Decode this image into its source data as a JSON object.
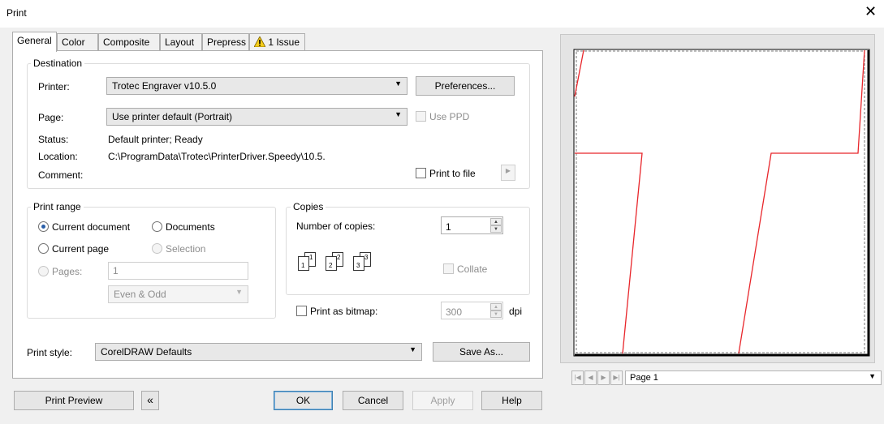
{
  "window": {
    "title": "Print",
    "close_glyph": "✕"
  },
  "tabs": [
    {
      "label": "General",
      "active": true
    },
    {
      "label": "Color"
    },
    {
      "label": "Composite"
    },
    {
      "label": "Layout"
    },
    {
      "label": "Prepress"
    },
    {
      "label": "1 Issue",
      "icon": "warning-icon"
    }
  ],
  "destination": {
    "legend": "Destination",
    "printer_label": "Printer:",
    "printer_value": "Trotec Engraver v10.5.0",
    "preferences_button": "Preferences...",
    "page_label": "Page:",
    "page_value": "Use printer default (Portrait)",
    "use_ppd_label": "Use PPD",
    "status_label": "Status:",
    "status_value": "Default printer; Ready",
    "location_label": "Location:",
    "location_value": "C:\\ProgramData\\Trotec\\PrinterDriver.Speedy\\10.5.",
    "comment_label": "Comment:",
    "print_to_file_label": "Print to file"
  },
  "print_range": {
    "legend": "Print range",
    "current_document": "Current document",
    "documents": "Documents",
    "current_page": "Current page",
    "selection": "Selection",
    "pages_label": "Pages:",
    "pages_value": "1",
    "parity_value": "Even & Odd"
  },
  "copies": {
    "legend": "Copies",
    "number_label": "Number of copies:",
    "number_value": "1",
    "collate_label": "Collate",
    "icon_digits": [
      "1",
      "1",
      "2",
      "2",
      "3",
      "3"
    ]
  },
  "bitmap": {
    "label": "Print as bitmap:",
    "dpi_value": "300",
    "dpi_unit": "dpi"
  },
  "style": {
    "label": "Print style:",
    "value": "CorelDRAW Defaults",
    "save_as_button": "Save As..."
  },
  "footer": {
    "print_preview": "Print Preview",
    "collapse_glyph": "«",
    "ok": "OK",
    "cancel": "Cancel",
    "apply": "Apply",
    "help": "Help"
  },
  "preview_nav": {
    "page_value": "Page 1"
  },
  "colors": {
    "preview_line": "#e8262b",
    "accent": "#2a5fa8"
  }
}
